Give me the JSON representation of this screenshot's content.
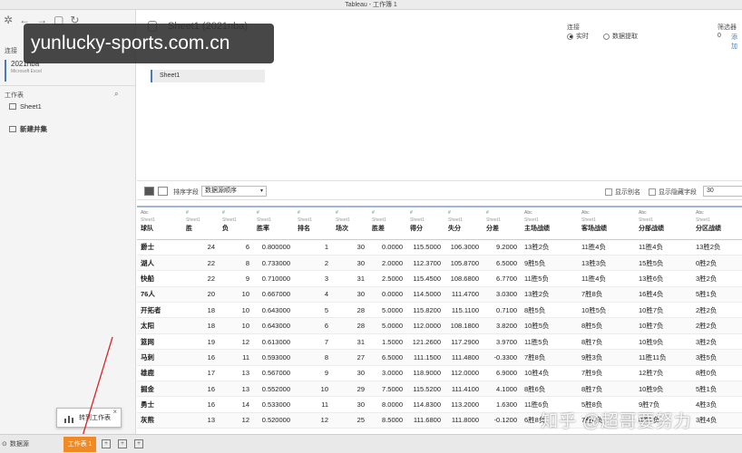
{
  "window": {
    "title": "Tableau - 工作簿 1"
  },
  "watermark": {
    "text": "yunlucky-sports.com.cn"
  },
  "sidebar": {
    "connections_label": "连接",
    "connection": {
      "name": "2021nba",
      "type": "Microsoft Excel"
    },
    "worksheets_label": "工作表",
    "sheets": [
      "Sheet1"
    ],
    "new_union_label": "新建并集"
  },
  "header": {
    "datasource_title": "Sheet1 (2021nba)",
    "connection_label": "连接",
    "connection_options": [
      {
        "label": "实时",
        "selected": true
      },
      {
        "label": "数据提取",
        "selected": false
      }
    ],
    "filter_label": "筛选器",
    "filter_count": "0",
    "filter_add": "添加",
    "canvas_sheet": "Sheet1"
  },
  "grid_toolbar": {
    "sort_label": "排序字段",
    "sort_value": "数据源顺序",
    "show_alias_label": "显示别名",
    "show_hidden_label": "显示隐藏字段",
    "rows_value": "30"
  },
  "table": {
    "columns": [
      {
        "type": "Abc",
        "source": "Sheet1",
        "name": "球队",
        "numeric": false,
        "bold": true
      },
      {
        "type": "#",
        "source": "Sheet1",
        "name": "胜",
        "numeric": true
      },
      {
        "type": "#",
        "source": "Sheet1",
        "name": "负",
        "numeric": true
      },
      {
        "type": "#",
        "source": "Sheet1",
        "name": "胜率",
        "numeric": false
      },
      {
        "type": "#",
        "source": "Sheet1",
        "name": "排名",
        "numeric": true
      },
      {
        "type": "#",
        "source": "Sheet1",
        "name": "场次",
        "numeric": true
      },
      {
        "type": "#",
        "source": "Sheet1",
        "name": "胜差",
        "numeric": true
      },
      {
        "type": "#",
        "source": "Sheet1",
        "name": "得分",
        "numeric": true
      },
      {
        "type": "#",
        "source": "Sheet1",
        "name": "失分",
        "numeric": true
      },
      {
        "type": "#",
        "source": "Sheet1",
        "name": "分差",
        "numeric": true
      },
      {
        "type": "Abc",
        "source": "Sheet1",
        "name": "主场战绩",
        "numeric": false
      },
      {
        "type": "Abc",
        "source": "Sheet1",
        "name": "客场战绩",
        "numeric": false
      },
      {
        "type": "Abc",
        "source": "Sheet1",
        "name": "分部战绩",
        "numeric": false
      },
      {
        "type": "Abc",
        "source": "Sheet1",
        "name": "分区战绩",
        "numeric": false
      }
    ],
    "rows": [
      [
        "爵士",
        "24",
        "6",
        "0.800000",
        "1",
        "30",
        "0.0000",
        "115.5000",
        "106.3000",
        "9.2000",
        "13胜2负",
        "11胜4负",
        "11胜4负",
        "13胜2负"
      ],
      [
        "湖人",
        "22",
        "8",
        "0.733000",
        "2",
        "30",
        "2.0000",
        "112.3700",
        "105.8700",
        "6.5000",
        "9胜5负",
        "13胜3负",
        "15胜5负",
        "0胜2负"
      ],
      [
        "快船",
        "22",
        "9",
        "0.710000",
        "3",
        "31",
        "2.5000",
        "115.4500",
        "108.6800",
        "6.7700",
        "11胜5负",
        "11胜4负",
        "13胜6负",
        "3胜2负"
      ],
      [
        "76人",
        "20",
        "10",
        "0.667000",
        "4",
        "30",
        "0.0000",
        "114.5000",
        "111.4700",
        "3.0300",
        "13胜2负",
        "7胜8负",
        "16胜4负",
        "5胜1负"
      ],
      [
        "开拓者",
        "18",
        "10",
        "0.643000",
        "5",
        "28",
        "5.0000",
        "115.8200",
        "115.1100",
        "0.7100",
        "8胜5负",
        "10胜5负",
        "10胜7负",
        "2胜2负"
      ],
      [
        "太阳",
        "18",
        "10",
        "0.643000",
        "6",
        "28",
        "5.0000",
        "112.0000",
        "108.1800",
        "3.8200",
        "10胜5负",
        "8胜5负",
        "10胜7负",
        "2胜2负"
      ],
      [
        "篮网",
        "19",
        "12",
        "0.613000",
        "7",
        "31",
        "1.5000",
        "121.2600",
        "117.2900",
        "3.9700",
        "11胜5负",
        "8胜7负",
        "10胜9负",
        "3胜2负"
      ],
      [
        "马刺",
        "16",
        "11",
        "0.593000",
        "8",
        "27",
        "6.5000",
        "111.1500",
        "111.4800",
        "-0.3300",
        "7胜8负",
        "9胜3负",
        "11胜11负",
        "3胜5负"
      ],
      [
        "雄鹿",
        "17",
        "13",
        "0.567000",
        "9",
        "30",
        "3.0000",
        "118.9000",
        "112.0000",
        "6.9000",
        "10胜4负",
        "7胜9负",
        "12胜7负",
        "8胜0负"
      ],
      [
        "掘金",
        "16",
        "13",
        "0.552000",
        "10",
        "29",
        "7.5000",
        "115.5200",
        "111.4100",
        "4.1000",
        "8胜6负",
        "8胜7负",
        "10胜9负",
        "5胜1负"
      ],
      [
        "勇士",
        "16",
        "14",
        "0.533000",
        "11",
        "30",
        "8.0000",
        "114.8300",
        "113.2000",
        "1.6300",
        "11胜6负",
        "5胜8负",
        "9胜7负",
        "4胜3负"
      ],
      [
        "灰熊",
        "13",
        "12",
        "0.520000",
        "12",
        "25",
        "8.5000",
        "111.6800",
        "111.8000",
        "-0.1200",
        "6胜8负",
        "7胜4负",
        "8胜7负",
        "3胜4负"
      ]
    ]
  },
  "status_bar": {
    "datasource_tab": "数据源",
    "sheet_tab": "工作表 1"
  },
  "tooltip": {
    "text": "转到工作表"
  },
  "bottom_watermark": {
    "text": "知乎 @超哥要努力"
  }
}
